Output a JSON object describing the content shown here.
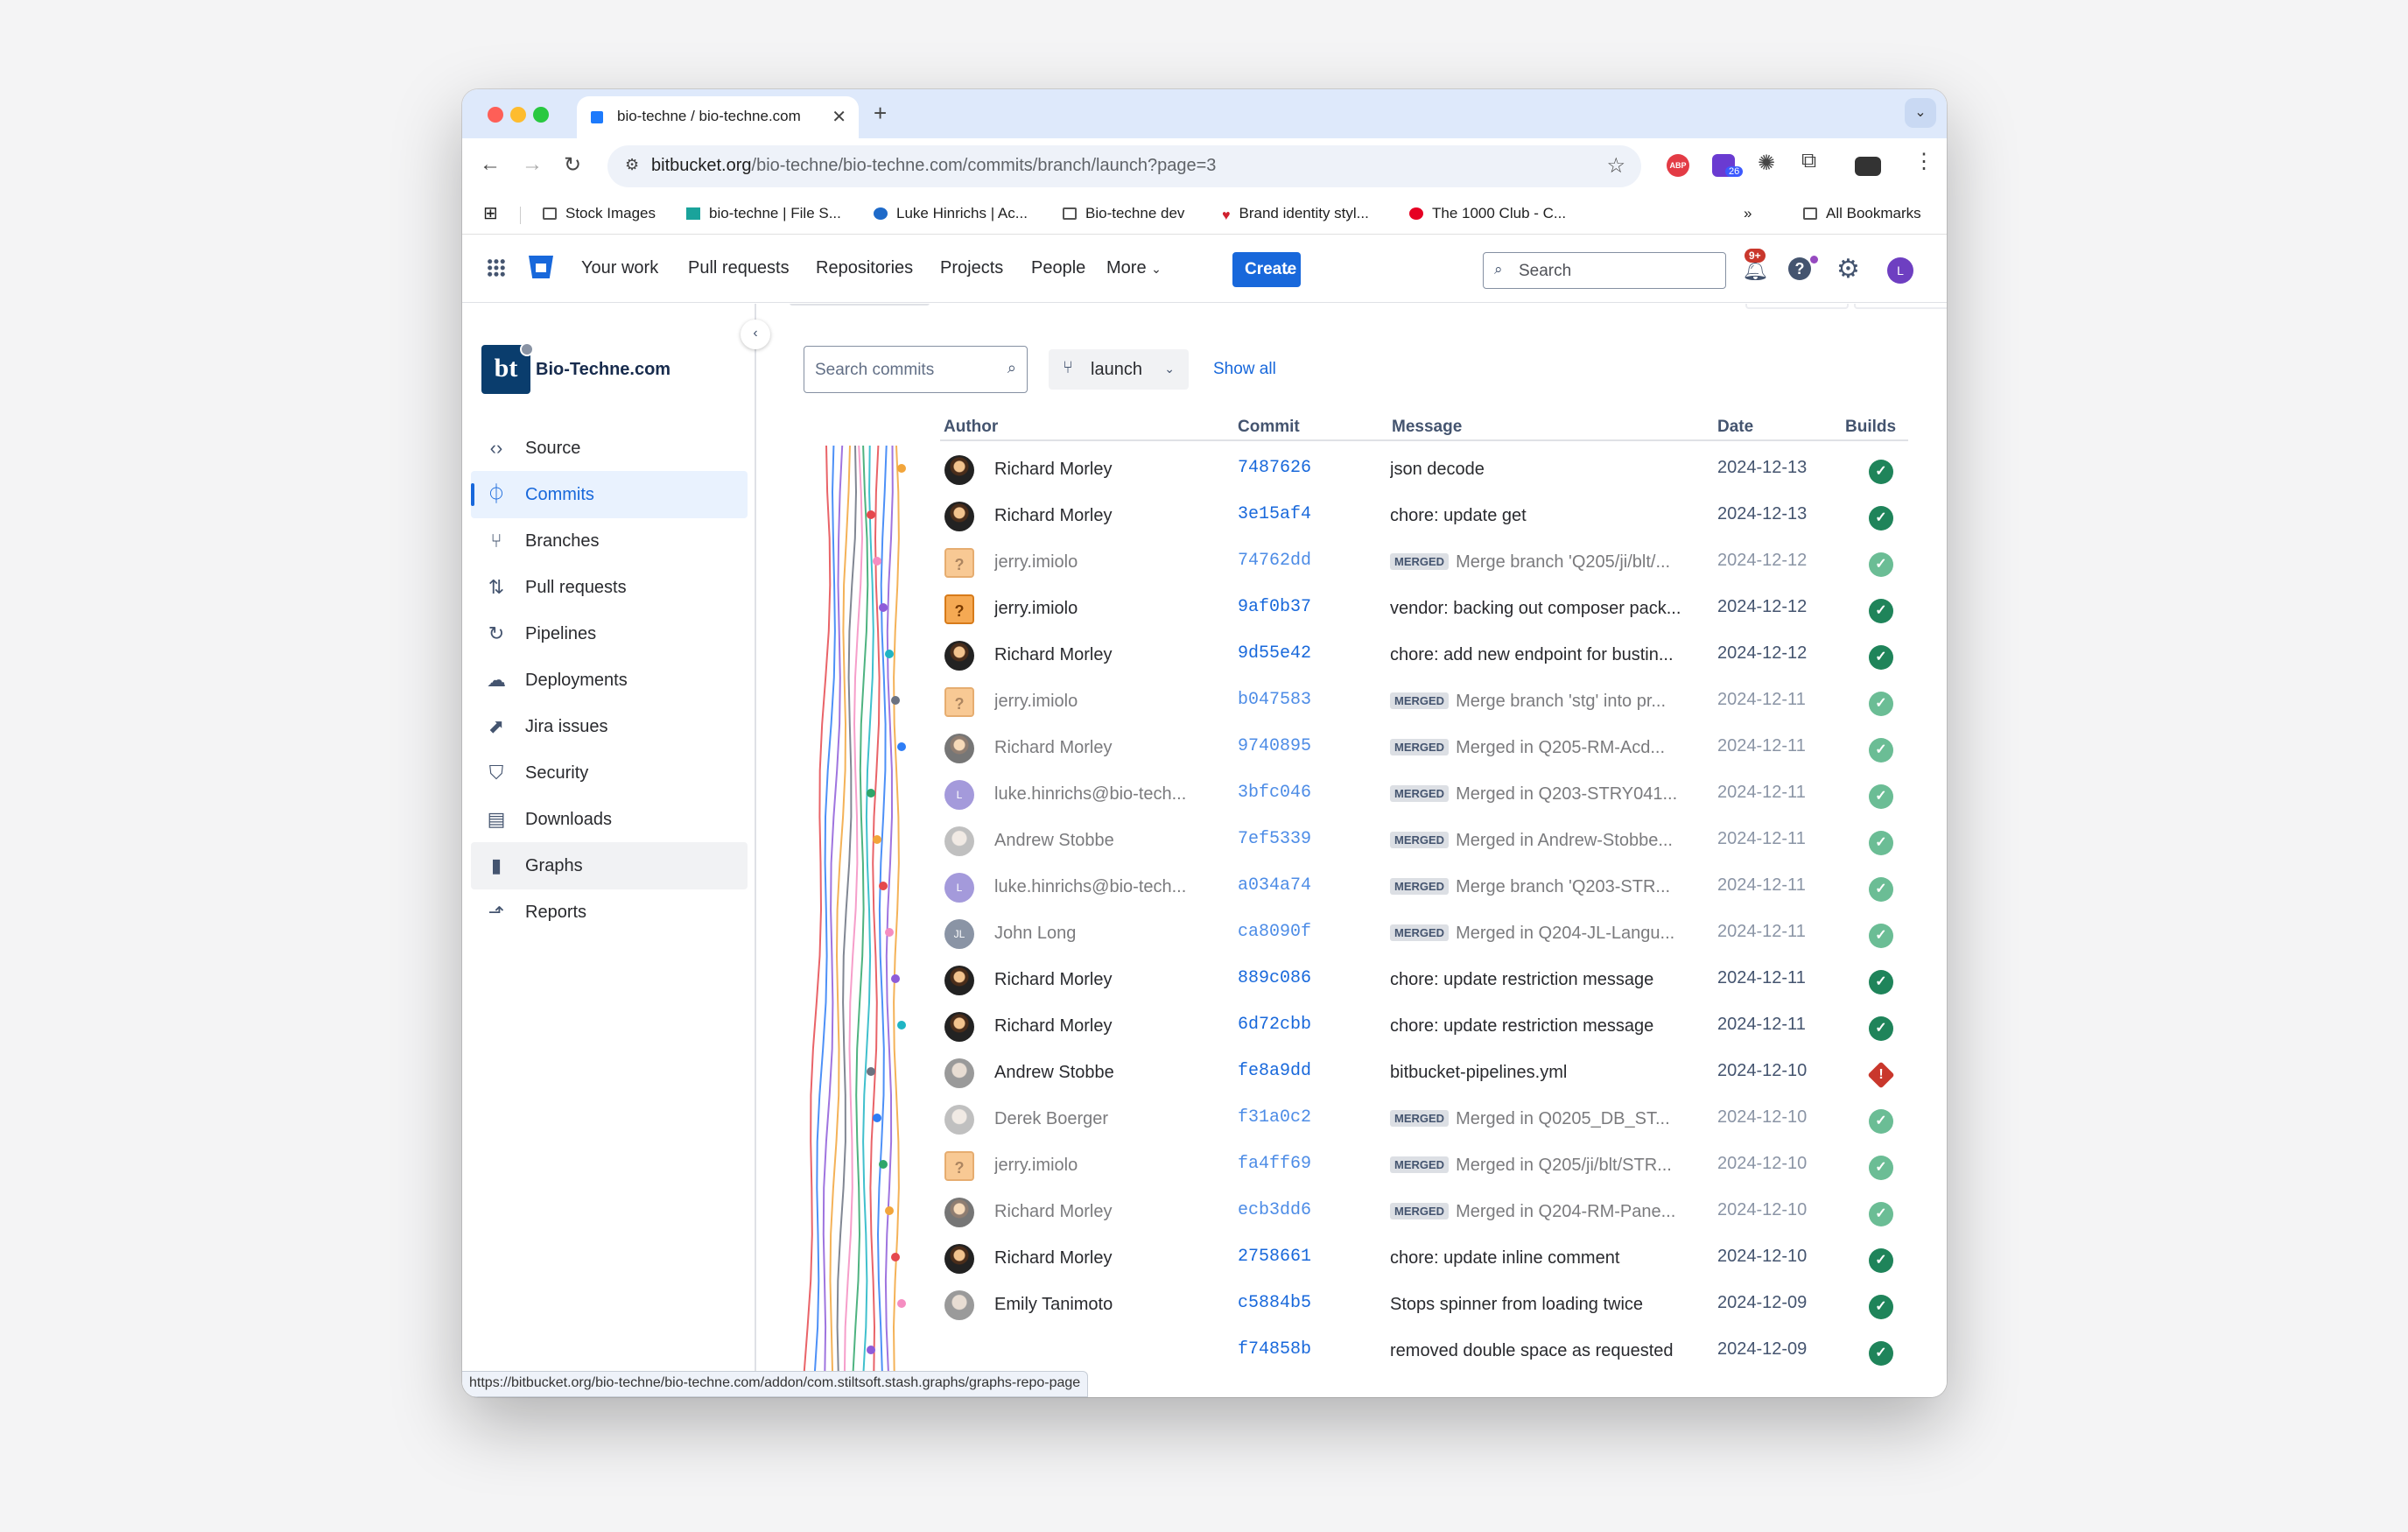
{
  "browser": {
    "tab_title": "bio-techne / bio-techne.com",
    "url_domain": "bitbucket.org",
    "url_path": "/bio-techne/bio-techne.com/commits/branch/launch?page=3",
    "ext_badge": "26",
    "bookmarks": [
      {
        "label": "Stock Images",
        "icon": "folder-icon"
      },
      {
        "label": "bio-techne | File S...",
        "icon": "file-share-icon"
      },
      {
        "label": "Luke Hinrichs | Ac...",
        "icon": "globe-icon"
      },
      {
        "label": "Bio-techne dev",
        "icon": "folder-icon"
      },
      {
        "label": "Brand identity styl...",
        "icon": "heart-icon"
      },
      {
        "label": "The 1000 Club - C...",
        "icon": "pinterest-icon"
      }
    ],
    "all_bookmarks": "All Bookmarks",
    "status_url": "https://bitbucket.org/bio-techne/bio-techne.com/addon/com.stiltsoft.stash.graphs/graphs-repo-page"
  },
  "topnav": {
    "items": [
      "Your work",
      "Pull requests",
      "Repositories",
      "Projects",
      "People",
      "More"
    ],
    "create": "Create",
    "search_placeholder": "Search",
    "notif_badge": "9+",
    "user_initial": "L"
  },
  "sidebar": {
    "repo_name": "Bio-Techne.com",
    "repo_logo": "bt",
    "items": [
      {
        "label": "Source",
        "icon": "code-icon"
      },
      {
        "label": "Commits",
        "icon": "commit-icon",
        "active": true
      },
      {
        "label": "Branches",
        "icon": "branch-icon"
      },
      {
        "label": "Pull requests",
        "icon": "pull-request-icon"
      },
      {
        "label": "Pipelines",
        "icon": "pipelines-icon"
      },
      {
        "label": "Deployments",
        "icon": "cloud-upload-icon"
      },
      {
        "label": "Jira issues",
        "icon": "jira-icon"
      },
      {
        "label": "Security",
        "icon": "shield-icon"
      },
      {
        "label": "Downloads",
        "icon": "document-icon"
      },
      {
        "label": "Graphs",
        "icon": "bar-chart-icon",
        "hover": true
      },
      {
        "label": "Reports",
        "icon": "line-chart-icon"
      }
    ]
  },
  "toolbar": {
    "search_placeholder": "Search commits",
    "branch": "launch",
    "show_all": "Show all"
  },
  "columns": {
    "author": "Author",
    "commit": "Commit",
    "message": "Message",
    "date": "Date",
    "builds": "Builds"
  },
  "merged_label": "MERGED",
  "commits": [
    {
      "author": "Richard Morley",
      "avatar": "dark",
      "hash": "7487626",
      "merged": false,
      "message": "json decode",
      "date": "2024-12-13",
      "build": "success"
    },
    {
      "author": "Richard Morley",
      "avatar": "dark",
      "hash": "3e15af4",
      "merged": false,
      "message": "chore: update get",
      "date": "2024-12-13",
      "build": "success"
    },
    {
      "author": "jerry.imiolo",
      "avatar": "q",
      "hash": "74762dd",
      "merged": true,
      "message": "Merge branch 'Q205/ji/blt/...",
      "date": "2024-12-12",
      "build": "success"
    },
    {
      "author": "jerry.imiolo",
      "avatar": "q",
      "hash": "9af0b37",
      "merged": false,
      "message": "vendor: backing out composer pack...",
      "date": "2024-12-12",
      "build": "success"
    },
    {
      "author": "Richard Morley",
      "avatar": "dark",
      "hash": "9d55e42",
      "merged": false,
      "message": "chore: add new endpoint for bustin...",
      "date": "2024-12-12",
      "build": "success"
    },
    {
      "author": "jerry.imiolo",
      "avatar": "q",
      "hash": "b047583",
      "merged": true,
      "message": "Merge branch 'stg' into pr...",
      "date": "2024-12-11",
      "build": "success"
    },
    {
      "author": "Richard Morley",
      "avatar": "dark",
      "hash": "9740895",
      "merged": true,
      "message": "Merged in Q205-RM-Acd...",
      "date": "2024-12-11",
      "build": "success"
    },
    {
      "author": "luke.hinrichs@bio-tech...",
      "avatar": "L",
      "hash": "3bfc046",
      "merged": true,
      "message": "Merged in Q203-STRY041...",
      "date": "2024-12-11",
      "build": "success"
    },
    {
      "author": "Andrew Stobbe",
      "avatar": "grey",
      "hash": "7ef5339",
      "merged": true,
      "message": "Merged in Andrew-Stobbe...",
      "date": "2024-12-11",
      "build": "success"
    },
    {
      "author": "luke.hinrichs@bio-tech...",
      "avatar": "L",
      "hash": "a034a74",
      "merged": true,
      "message": "Merge branch 'Q203-STR...",
      "date": "2024-12-11",
      "build": "success"
    },
    {
      "author": "John Long",
      "avatar": "JL",
      "hash": "ca8090f",
      "merged": true,
      "message": "Merged in Q204-JL-Langu...",
      "date": "2024-12-11",
      "build": "success"
    },
    {
      "author": "Richard Morley",
      "avatar": "dark",
      "hash": "889c086",
      "merged": false,
      "message": "chore: update restriction message",
      "date": "2024-12-11",
      "build": "success"
    },
    {
      "author": "Richard Morley",
      "avatar": "dark",
      "hash": "6d72cbb",
      "merged": false,
      "message": "chore: update restriction message",
      "date": "2024-12-11",
      "build": "success"
    },
    {
      "author": "Andrew Stobbe",
      "avatar": "grey",
      "hash": "fe8a9dd",
      "merged": false,
      "message": "bitbucket-pipelines.yml",
      "date": "2024-12-10",
      "build": "failed"
    },
    {
      "author": "Derek Boerger",
      "avatar": "grey",
      "hash": "f31a0c2",
      "merged": true,
      "message": "Merged in Q0205_DB_ST...",
      "date": "2024-12-10",
      "build": "success"
    },
    {
      "author": "jerry.imiolo",
      "avatar": "q",
      "hash": "fa4ff69",
      "merged": true,
      "message": "Merged in Q205/ji/blt/STR...",
      "date": "2024-12-10",
      "build": "success"
    },
    {
      "author": "Richard Morley",
      "avatar": "dark",
      "hash": "ecb3dd6",
      "merged": true,
      "message": "Merged in Q204-RM-Pane...",
      "date": "2024-12-10",
      "build": "success"
    },
    {
      "author": "Richard Morley",
      "avatar": "dark",
      "hash": "2758661",
      "merged": false,
      "message": "chore: update inline comment",
      "date": "2024-12-10",
      "build": "success"
    },
    {
      "author": "Emily Tanimoto",
      "avatar": "grey",
      "hash": "c5884b5",
      "merged": false,
      "message": "Stops spinner from loading twice",
      "date": "2024-12-09",
      "build": "success"
    },
    {
      "author": "",
      "avatar": "none",
      "hash": "f74858b",
      "merged": false,
      "message": "removed double space as requested",
      "date": "2024-12-09",
      "build": "success"
    }
  ],
  "graph_colors": [
    "#f2a53b",
    "#8e5cd9",
    "#2e7df6",
    "#e5484d",
    "#1fb5c4",
    "#2fa66a",
    "#f58dc1",
    "#6b7280"
  ]
}
